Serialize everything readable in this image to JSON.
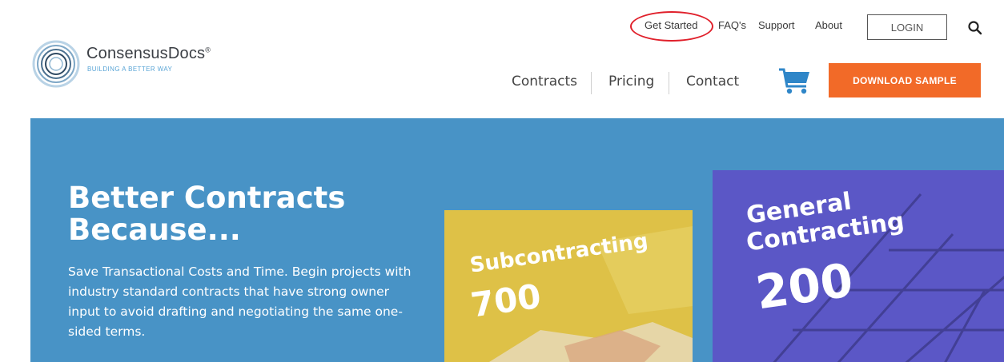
{
  "brand": {
    "name": "ConsensusDocs",
    "registered": "®",
    "tagline": "BUILDING A BETTER WAY"
  },
  "top_nav": {
    "get_started": "Get Started",
    "faqs": "FAQ's",
    "support": "Support",
    "about": "About",
    "login": "LOGIN"
  },
  "main_nav": {
    "contracts": "Contracts",
    "pricing": "Pricing",
    "contact": "Contact",
    "download_sample": "DOWNLOAD SAMPLE"
  },
  "hero": {
    "title": "Better Contracts Because...",
    "text": "Save Transactional Costs and Time. Begin projects with industry standard contracts that have strong owner input to avoid drafting and negotiating the same one-sided terms."
  },
  "cards": {
    "subcontracting": {
      "label": "Subcontracting",
      "number": "700"
    },
    "general": {
      "label_line1": "General",
      "label_line2": "Contracting",
      "number": "200"
    }
  },
  "colors": {
    "accent_orange": "#f26a28",
    "hero_blue": "#4893c6",
    "card_yellow": "#dec147",
    "card_purple": "#5b57c6",
    "highlight_red": "#e0202b",
    "cart_blue": "#2f86c8"
  },
  "icons": {
    "logo": "consensusdocs-logo",
    "cart": "shopping-cart-icon",
    "search": "search-icon"
  }
}
